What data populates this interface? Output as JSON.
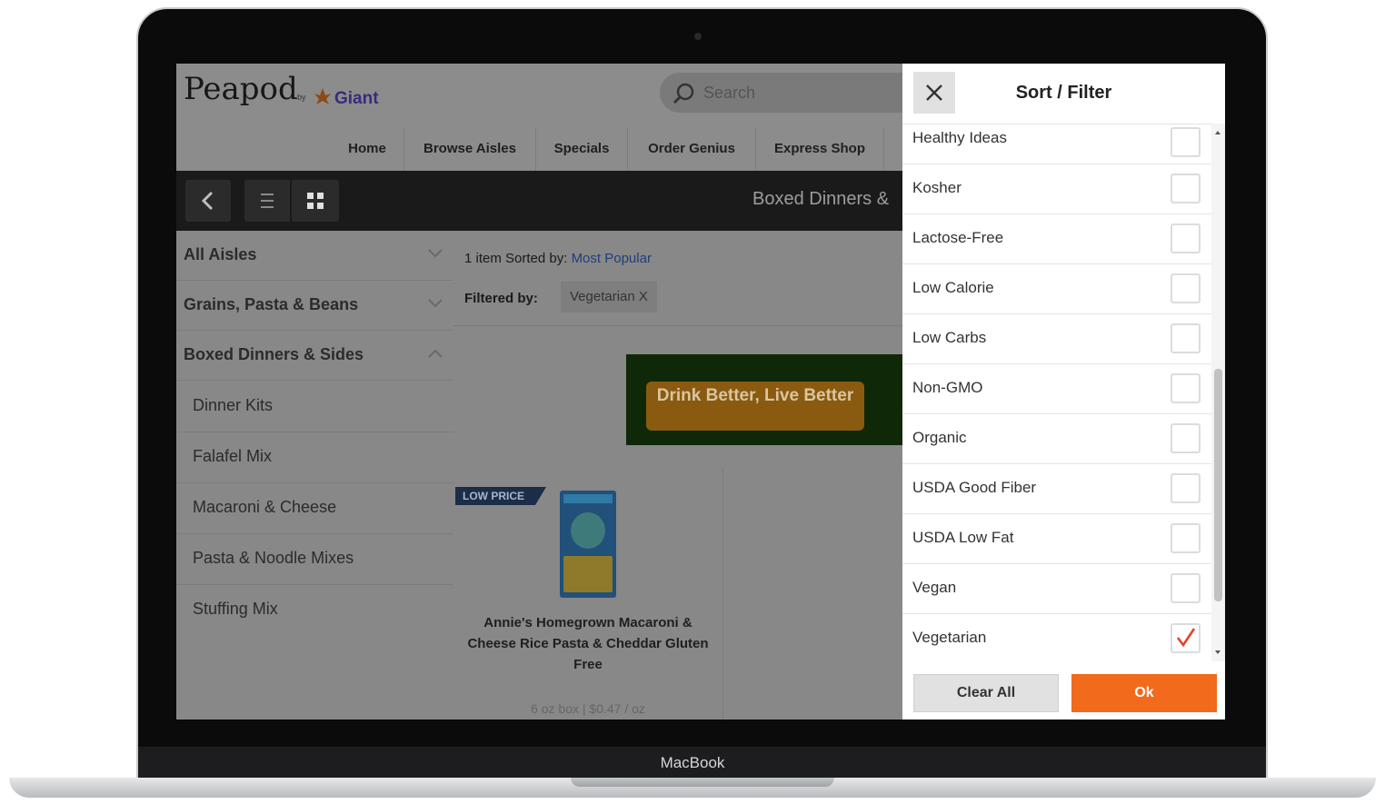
{
  "device": {
    "label": "MacBook"
  },
  "header": {
    "logo": "Peapod",
    "logo_by": "by",
    "logo_partner": "Giant",
    "search_placeholder": "Search",
    "nav": [
      "Home",
      "Browse Aisles",
      "Specials",
      "Order Genius",
      "Express Shop"
    ]
  },
  "toolbar": {
    "title": "Boxed Dinners &"
  },
  "sidebar": {
    "items": [
      {
        "label": "All Aisles",
        "chevron": "down"
      },
      {
        "label": "Grains, Pasta & Beans",
        "chevron": "down"
      },
      {
        "label": "Boxed Dinners & Sides",
        "chevron": "up"
      }
    ],
    "subitems": [
      "Dinner Kits",
      "Falafel Mix",
      "Macaroni & Cheese",
      "Pasta & Noodle Mixes",
      "Stuffing Mix"
    ]
  },
  "results": {
    "summary_prefix": "1 item  Sorted by:",
    "sort_value": "Most Popular",
    "filtered_label": "Filtered by:",
    "filter_chip": "Vegetarian X",
    "banner_text": "Drink Better, Live Better",
    "product": {
      "badge": "LOW PRICE",
      "name": "Annie's Homegrown Macaroni & Cheese Rice Pasta & Cheddar Gluten Free",
      "price": "6 oz box | $0.47 / oz"
    }
  },
  "panel": {
    "title": "Sort / Filter",
    "options": [
      {
        "label": "Healthy Ideas",
        "checked": false
      },
      {
        "label": "Kosher",
        "checked": false
      },
      {
        "label": "Lactose-Free",
        "checked": false
      },
      {
        "label": "Low Calorie",
        "checked": false
      },
      {
        "label": "Low Carbs",
        "checked": false
      },
      {
        "label": "Non-GMO",
        "checked": false
      },
      {
        "label": "Organic",
        "checked": false
      },
      {
        "label": "USDA Good Fiber",
        "checked": false
      },
      {
        "label": "USDA Low Fat",
        "checked": false
      },
      {
        "label": "Vegan",
        "checked": false
      },
      {
        "label": "Vegetarian",
        "checked": true
      }
    ],
    "clear_label": "Clear All",
    "ok_label": "Ok"
  },
  "colors": {
    "accent": "#f26a1c",
    "check": "#e8412a",
    "link": "#1e3f7a"
  },
  "icons": {
    "close": "close-icon",
    "search": "search-icon",
    "back": "chevron-left-icon",
    "list": "list-view-icon",
    "grid": "grid-view-icon",
    "check": "checkmark-icon"
  }
}
